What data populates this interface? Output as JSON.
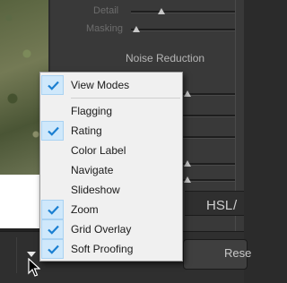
{
  "panel": {
    "detail_label": "Detail",
    "masking_label": "Masking",
    "section_heading": "Noise Reduction",
    "hsl_tab_label": "HSL",
    "hsl_separator": "/",
    "toolbar_button_label": "Rese"
  },
  "menu": {
    "items": [
      {
        "label": "View Modes",
        "checked": true
      },
      {
        "label": "Flagging",
        "checked": false
      },
      {
        "label": "Rating",
        "checked": true
      },
      {
        "label": "Color Label",
        "checked": false
      },
      {
        "label": "Navigate",
        "checked": false
      },
      {
        "label": "Slideshow",
        "checked": false
      },
      {
        "label": "Zoom",
        "checked": true
      },
      {
        "label": "Grid Overlay",
        "checked": true
      },
      {
        "label": "Soft Proofing",
        "checked": true
      }
    ]
  },
  "colors": {
    "check_accent": "#1a7fd1",
    "check_background": "#cfe8fb",
    "menu_background": "#f0f0f0",
    "panel_background": "#393939"
  },
  "icons": {
    "check": "checkmark-icon",
    "toolbar_dropdown": "dropdown-triangle-icon",
    "pointer": "mouse-cursor-icon"
  }
}
